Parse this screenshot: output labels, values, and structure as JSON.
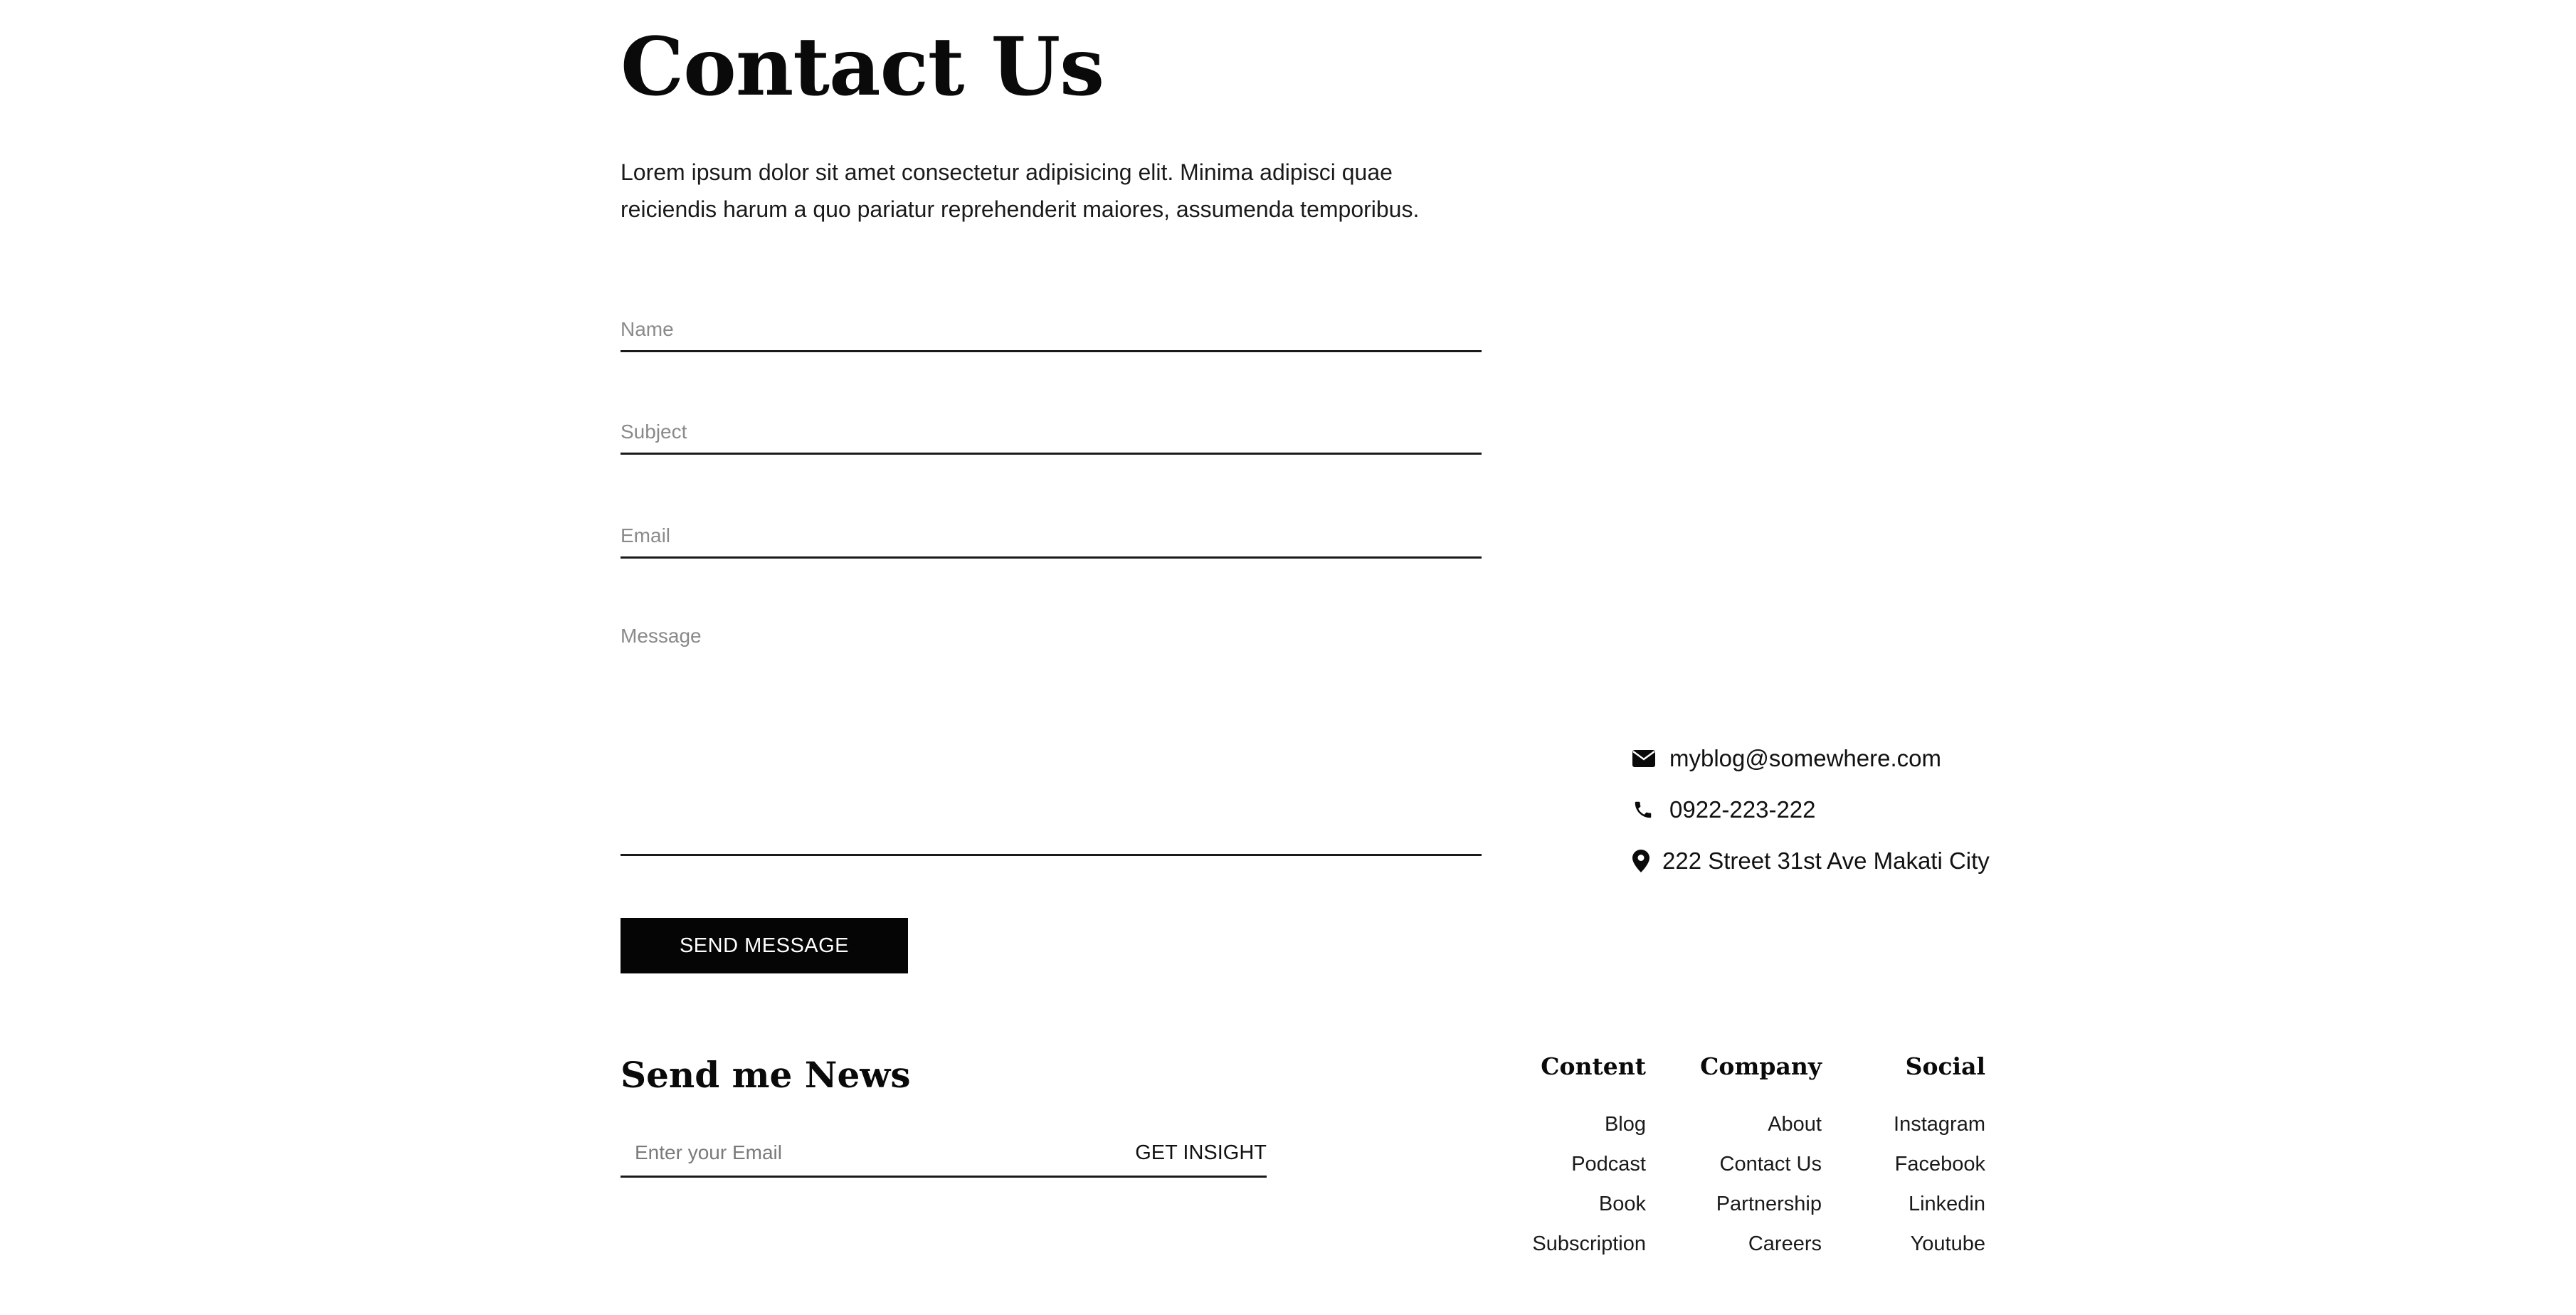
{
  "page": {
    "title": "Contact Us",
    "intro": "Lorem ipsum dolor sit amet consectetur adipisicing elit. Minima adipisci quae reiciendis harum a quo pariatur reprehenderit maiores, assumenda temporibus."
  },
  "form": {
    "name_placeholder": "Name",
    "subject_placeholder": "Subject",
    "email_placeholder": "Email",
    "message_placeholder": "Message",
    "submit_label": "SEND MESSAGE"
  },
  "contact": {
    "email": "myblog@somewhere.com",
    "phone": "0922-223-222",
    "address": "222 Street 31st Ave Makati City",
    "icons": [
      "envelope-icon",
      "phone-icon",
      "map-pin-icon"
    ]
  },
  "newsletter": {
    "title": "Send me News",
    "placeholder": "Enter your Email",
    "button_label": "GET INSIGHT"
  },
  "footer": {
    "columns": [
      {
        "heading": "Content",
        "links": [
          "Blog",
          "Podcast",
          "Book",
          "Subscription"
        ]
      },
      {
        "heading": "Company",
        "links": [
          "About",
          "Contact Us",
          "Partnership",
          "Careers"
        ]
      },
      {
        "heading": "Social",
        "links": [
          "Instagram",
          "Facebook",
          "Linkedin",
          "Youtube"
        ]
      }
    ]
  },
  "colors": {
    "text": "#111111",
    "button_bg": "#050505",
    "button_text": "#ffffff",
    "placeholder": "#8a8a8a",
    "rule": "#1a1a1a"
  }
}
